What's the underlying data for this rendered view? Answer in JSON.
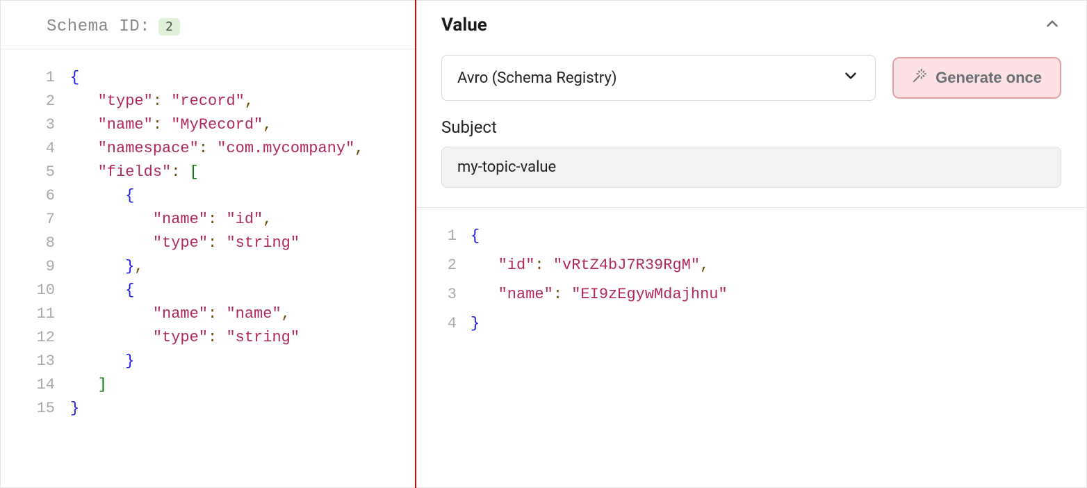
{
  "left": {
    "schema_id_label": "Schema ID:",
    "schema_id_value": "2",
    "code_lines": [
      [
        {
          "t": "brace",
          "v": "{"
        }
      ],
      [
        {
          "t": "sp",
          "v": "   "
        },
        {
          "t": "key",
          "v": "\"type\""
        },
        {
          "t": "punc",
          "v": ": "
        },
        {
          "t": "str",
          "v": "\"record\""
        },
        {
          "t": "punc",
          "v": ","
        }
      ],
      [
        {
          "t": "sp",
          "v": "   "
        },
        {
          "t": "key",
          "v": "\"name\""
        },
        {
          "t": "punc",
          "v": ": "
        },
        {
          "t": "str",
          "v": "\"MyRecord\""
        },
        {
          "t": "punc",
          "v": ","
        }
      ],
      [
        {
          "t": "sp",
          "v": "   "
        },
        {
          "t": "key",
          "v": "\"namespace\""
        },
        {
          "t": "punc",
          "v": ": "
        },
        {
          "t": "str",
          "v": "\"com.mycompany\""
        },
        {
          "t": "punc",
          "v": ","
        }
      ],
      [
        {
          "t": "sp",
          "v": "   "
        },
        {
          "t": "key",
          "v": "\"fields\""
        },
        {
          "t": "punc",
          "v": ": "
        },
        {
          "t": "bracket",
          "v": "["
        }
      ],
      [
        {
          "t": "sp",
          "v": "      "
        },
        {
          "t": "brace",
          "v": "{"
        }
      ],
      [
        {
          "t": "sp",
          "v": "         "
        },
        {
          "t": "key",
          "v": "\"name\""
        },
        {
          "t": "punc",
          "v": ": "
        },
        {
          "t": "str",
          "v": "\"id\""
        },
        {
          "t": "punc",
          "v": ","
        }
      ],
      [
        {
          "t": "sp",
          "v": "         "
        },
        {
          "t": "key",
          "v": "\"type\""
        },
        {
          "t": "punc",
          "v": ": "
        },
        {
          "t": "str",
          "v": "\"string\""
        }
      ],
      [
        {
          "t": "sp",
          "v": "      "
        },
        {
          "t": "brace",
          "v": "}"
        },
        {
          "t": "punc",
          "v": ","
        }
      ],
      [
        {
          "t": "sp",
          "v": "      "
        },
        {
          "t": "brace",
          "v": "{"
        }
      ],
      [
        {
          "t": "sp",
          "v": "         "
        },
        {
          "t": "key",
          "v": "\"name\""
        },
        {
          "t": "punc",
          "v": ": "
        },
        {
          "t": "str",
          "v": "\"name\""
        },
        {
          "t": "punc",
          "v": ","
        }
      ],
      [
        {
          "t": "sp",
          "v": "         "
        },
        {
          "t": "key",
          "v": "\"type\""
        },
        {
          "t": "punc",
          "v": ": "
        },
        {
          "t": "str",
          "v": "\"string\""
        }
      ],
      [
        {
          "t": "sp",
          "v": "      "
        },
        {
          "t": "brace",
          "v": "}"
        }
      ],
      [
        {
          "t": "sp",
          "v": "   "
        },
        {
          "t": "bracket",
          "v": "]"
        }
      ],
      [
        {
          "t": "brace",
          "v": "}"
        }
      ]
    ]
  },
  "right": {
    "title": "Value",
    "format_select": "Avro (Schema Registry)",
    "generate_label": "Generate once",
    "subject_label": "Subject",
    "subject_value": "my-topic-value",
    "code_lines": [
      [
        {
          "t": "brace",
          "v": "{"
        }
      ],
      [
        {
          "t": "sp",
          "v": "   "
        },
        {
          "t": "key",
          "v": "\"id\""
        },
        {
          "t": "punc",
          "v": ": "
        },
        {
          "t": "str",
          "v": "\"vRtZ4bJ7R39RgM\""
        },
        {
          "t": "punc",
          "v": ","
        }
      ],
      [
        {
          "t": "sp",
          "v": "   "
        },
        {
          "t": "key",
          "v": "\"name\""
        },
        {
          "t": "punc",
          "v": ": "
        },
        {
          "t": "str",
          "v": "\"EI9zEgywMdajhnu\""
        }
      ],
      [
        {
          "t": "brace",
          "v": "}"
        }
      ]
    ]
  }
}
